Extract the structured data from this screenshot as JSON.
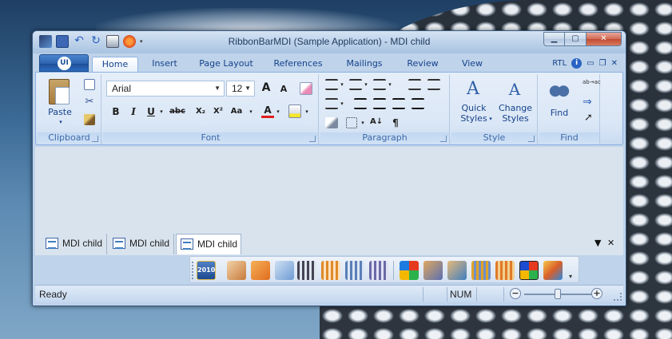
{
  "window": {
    "title": "RibbonBarMDI (Sample Application) - MDI child",
    "minimize_icon": "minimize-icon",
    "maximize_icon": "maximize-icon",
    "close_icon": "close-icon"
  },
  "app_button": {
    "logo": "UI"
  },
  "tabs": [
    {
      "label": "Home",
      "active": true
    },
    {
      "label": "Insert"
    },
    {
      "label": "Page Layout"
    },
    {
      "label": "References"
    },
    {
      "label": "Mailings"
    },
    {
      "label": "Review"
    },
    {
      "label": "View"
    }
  ],
  "tab_right": {
    "rtl_label": "RTL",
    "help": "i"
  },
  "groups": {
    "clipboard": {
      "label": "Clipboard",
      "paste_label": "Paste"
    },
    "font": {
      "label": "Font",
      "font_name": "Arial",
      "font_size": "12",
      "bold": "B",
      "italic": "I",
      "underline": "U",
      "strike": "abc",
      "subscript": "X₂",
      "superscript": "X²",
      "case": "Aa",
      "grow": "A",
      "shrink": "A",
      "color": "A"
    },
    "paragraph": {
      "label": "Paragraph",
      "pilcrow": "¶"
    },
    "style": {
      "label": "Style",
      "quick_styles": "Quick Styles",
      "quick_styles_line1": "Quick",
      "quick_styles_line2": "Styles",
      "change_styles_line1": "Change",
      "change_styles_line2": "Styles"
    },
    "find": {
      "label": "Find",
      "find_label": "Find",
      "replace_label": "ab→ac"
    }
  },
  "mdi_tabs": [
    {
      "label": "MDI child"
    },
    {
      "label": "MDI child"
    },
    {
      "label": "MDI child",
      "active": true
    }
  ],
  "strip": {
    "badge": "2010"
  },
  "status": {
    "text": "Ready",
    "num": "NUM",
    "zoom_minus": "−",
    "zoom_plus": "+"
  }
}
